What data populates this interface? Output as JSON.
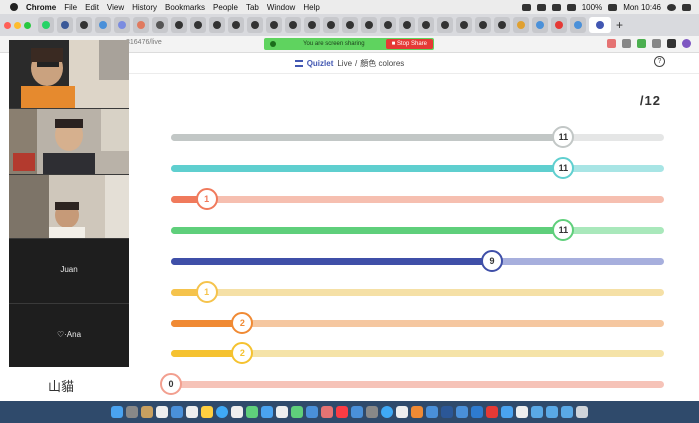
{
  "menubar": {
    "items": [
      "Chrome",
      "File",
      "Edit",
      "View",
      "History",
      "Bookmarks",
      "People",
      "Tab",
      "Window",
      "Help"
    ],
    "battery": "100%",
    "clock": "Mon 10:46"
  },
  "browser": {
    "url_suffix": "316476/live",
    "sharing_text": "You are screen sharing",
    "stop_share_label": "Stop Share"
  },
  "quizlet": {
    "brand": "Quizlet",
    "live_label": "Live",
    "set_title": "顏色 colores",
    "total": "/12",
    "team_name": "山貓"
  },
  "participants": [
    {
      "name": ""
    },
    {
      "name": ""
    },
    {
      "name": ""
    },
    {
      "name": "Juan"
    },
    {
      "name": "♡·Ana"
    }
  ],
  "colors": {
    "accent": "#4257b2",
    "share_green": "#5fd35f",
    "stop_red": "#e53935"
  },
  "progress": [
    {
      "value": 11,
      "max": 12,
      "fill": "#c2c7c6",
      "track": "#e5e6e6",
      "border": "#c2c7c6"
    },
    {
      "value": 11,
      "max": 12,
      "fill": "#5fcfcf",
      "track": "#a8e5e5",
      "border": "#5fcfcf"
    },
    {
      "value": 1,
      "max": 12,
      "fill": "#f07a5c",
      "track": "#f6bfb0",
      "border": "#f07a5c"
    },
    {
      "value": 11,
      "max": 12,
      "fill": "#5fcf7b",
      "track": "#a9e8bb",
      "border": "#5fcf7b"
    },
    {
      "value": 9,
      "max": 12,
      "fill": "#3f4fa8",
      "track": "#a7afdd",
      "border": "#3f4fa8"
    },
    {
      "value": 1,
      "max": 12,
      "fill": "#f5c34c",
      "track": "#f5e0a6",
      "border": "#f5c34c"
    },
    {
      "value": 2,
      "max": 12,
      "fill": "#f08a34",
      "track": "#f5c7a0",
      "border": "#f08a34"
    },
    {
      "value": 2,
      "max": 12,
      "fill": "#f5c230",
      "track": "#f5e3a8",
      "border": "#f5c230"
    },
    {
      "value": 0,
      "max": 12,
      "fill": "#f29f8f",
      "track": "#f6c3b8",
      "border": "#f29f8f"
    }
  ]
}
